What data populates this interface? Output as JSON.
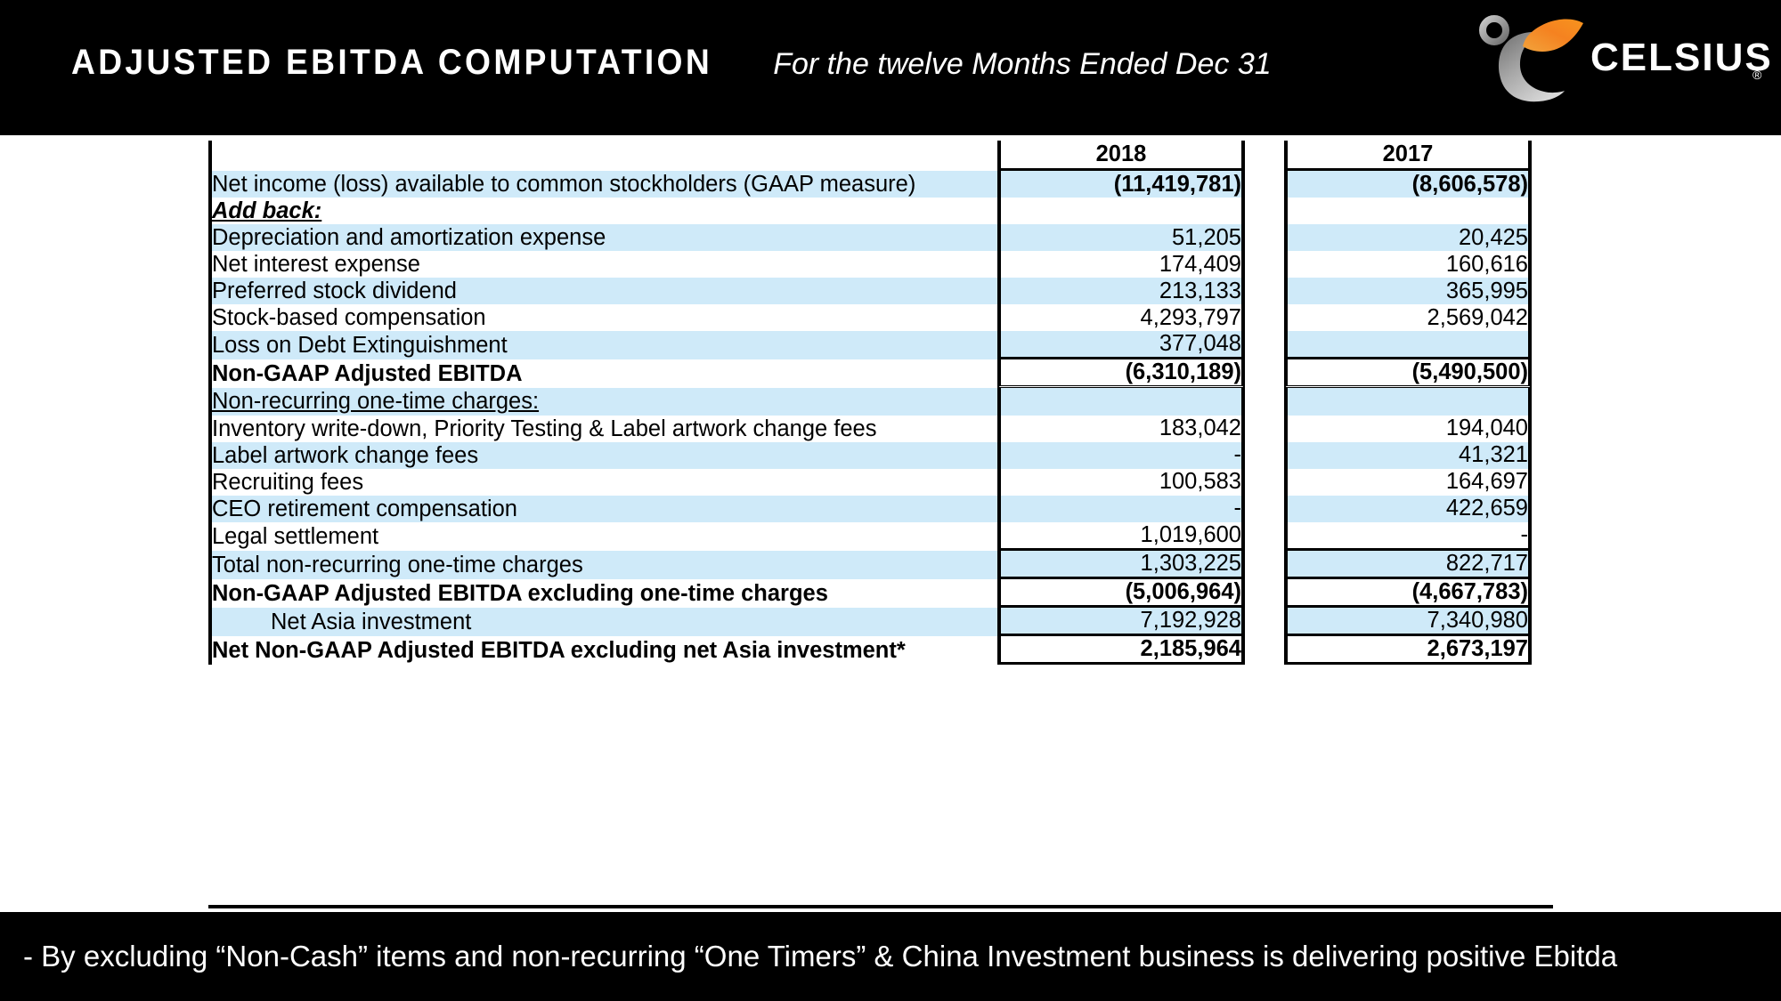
{
  "header": {
    "title": "ADJUSTED EBITDA COMPUTATION",
    "subtitle": "For the twelve Months Ended Dec 31",
    "logo_text": "CELSIUS",
    "logo_registered": "®",
    "logo_icon": "celsius-flame-c-logo"
  },
  "colors": {
    "header_bg": "#000000",
    "row_blue": "#cfeaf9",
    "row_white": "#ffffff",
    "logo_orange": "#F58220",
    "logo_gray": "#9B9B9B",
    "text": "#000000",
    "header_text": "#ffffff"
  },
  "table": {
    "columns": [
      "",
      "2018",
      "2017"
    ],
    "rows": [
      {
        "label": "",
        "y2018": "2018",
        "y2017": "2017",
        "style": "header",
        "shade": "white"
      },
      {
        "label": "Net income (loss) available to common stockholders (GAAP measure)",
        "y2018": "(11,419,781)",
        "y2017": "(8,606,578)",
        "style": "bold-value",
        "shade": "blue"
      },
      {
        "label": "Add back:",
        "y2018": "",
        "y2017": "",
        "style": "bold-italic-underline",
        "shade": "white"
      },
      {
        "label": "Depreciation and amortization expense",
        "y2018": "51,205",
        "y2017": "20,425",
        "style": "normal",
        "shade": "blue"
      },
      {
        "label": "Net interest expense",
        "y2018": "174,409",
        "y2017": "160,616",
        "style": "normal",
        "shade": "white"
      },
      {
        "label": "Preferred stock dividend",
        "y2018": "213,133",
        "y2017": "365,995",
        "style": "normal",
        "shade": "blue"
      },
      {
        "label": "Stock-based compensation",
        "y2018": "4,293,797",
        "y2017": "2,569,042",
        "style": "normal",
        "shade": "white"
      },
      {
        "label": "Loss on Debt Extinguishment",
        "y2018": "377,048",
        "y2017": "",
        "style": "normal-underlined-total",
        "shade": "blue"
      },
      {
        "label": "Non-GAAP Adjusted EBITDA",
        "y2018": "(6,310,189)",
        "y2017": "(5,490,500)",
        "style": "subtotal-bold-double",
        "shade": "white"
      },
      {
        "label": "Non-recurring one-time charges:",
        "y2018": "",
        "y2017": "",
        "style": "underline",
        "shade": "blue"
      },
      {
        "label": "Inventory write-down, Priority Testing & Label artwork change fees",
        "y2018": "183,042",
        "y2017": "194,040",
        "style": "normal",
        "shade": "white"
      },
      {
        "label": "Label artwork change fees",
        "y2018": "-",
        "y2017": "41,321",
        "style": "normal",
        "shade": "blue"
      },
      {
        "label": "Recruiting fees",
        "y2018": "100,583",
        "y2017": "164,697",
        "style": "normal",
        "shade": "white"
      },
      {
        "label": "CEO retirement compensation",
        "y2018": "-",
        "y2017": "422,659",
        "style": "normal",
        "shade": "blue"
      },
      {
        "label": "Legal settlement",
        "y2018": "1,019,600",
        "y2017": "-",
        "style": "normal-bottom-rule",
        "shade": "white"
      },
      {
        "label": "Total non-recurring one-time charges",
        "y2018": "1,303,225",
        "y2017": "822,717",
        "style": "total",
        "shade": "blue"
      },
      {
        "label": "Non-GAAP Adjusted EBITDA excluding one-time charges",
        "y2018": "(5,006,964)",
        "y2017": "(4,667,783)",
        "style": "bold-total",
        "shade": "white"
      },
      {
        "label": "Net Asia investment",
        "y2018": "7,192,928",
        "y2017": "7,340,980",
        "style": "indented-total",
        "shade": "blue"
      },
      {
        "label": "Net Non-GAAP Adjusted EBITDA excluding net Asia investment*",
        "y2018": "2,185,964",
        "y2017": "2,673,197",
        "style": "bold-grand-total",
        "shade": "white"
      }
    ]
  },
  "footer": {
    "note": "- By excluding “Non-Cash” items and non-recurring “One Timers” & China Investment business is delivering positive Ebitda"
  }
}
